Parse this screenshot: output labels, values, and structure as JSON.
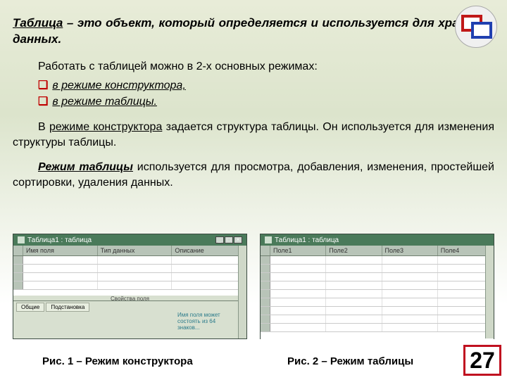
{
  "logo": {
    "name": "rectangles-logo"
  },
  "title": {
    "term": "Таблица",
    "rest": " – это объект, который определяется и используется для хранения данных."
  },
  "intro": "Работать с таблицей можно в 2-х основных режимах:",
  "modes": [
    "в режиме конструктора,",
    "в режиме таблицы."
  ],
  "para2": {
    "lead_in": "В ",
    "under": "режиме конструктора",
    "after": " задается структура таблицы. Он используется для изменения структуры таблицы."
  },
  "para3": {
    "b_under_ital": "Режим таблицы",
    "rest": " используется для просмотра, добавления, изменения, простейшей сортировки, удаления данных."
  },
  "fig1": {
    "title": "Таблица1 : таблица",
    "cols": [
      "Имя поля",
      "Тип данных",
      "Описание"
    ],
    "section": "Свойства поля",
    "tabs": [
      "Общие",
      "Подстановка"
    ],
    "hint": "Имя поля может состоять из 64 знаков..."
  },
  "fig2": {
    "title": "Таблица1 : таблица",
    "cols": [
      "Поле1",
      "Поле2",
      "Поле3",
      "Поле4"
    ]
  },
  "captions": {
    "c1": "Рис. 1 – Режим конструктора",
    "c2": "Рис. 2 – Режим таблицы"
  },
  "page": "27"
}
